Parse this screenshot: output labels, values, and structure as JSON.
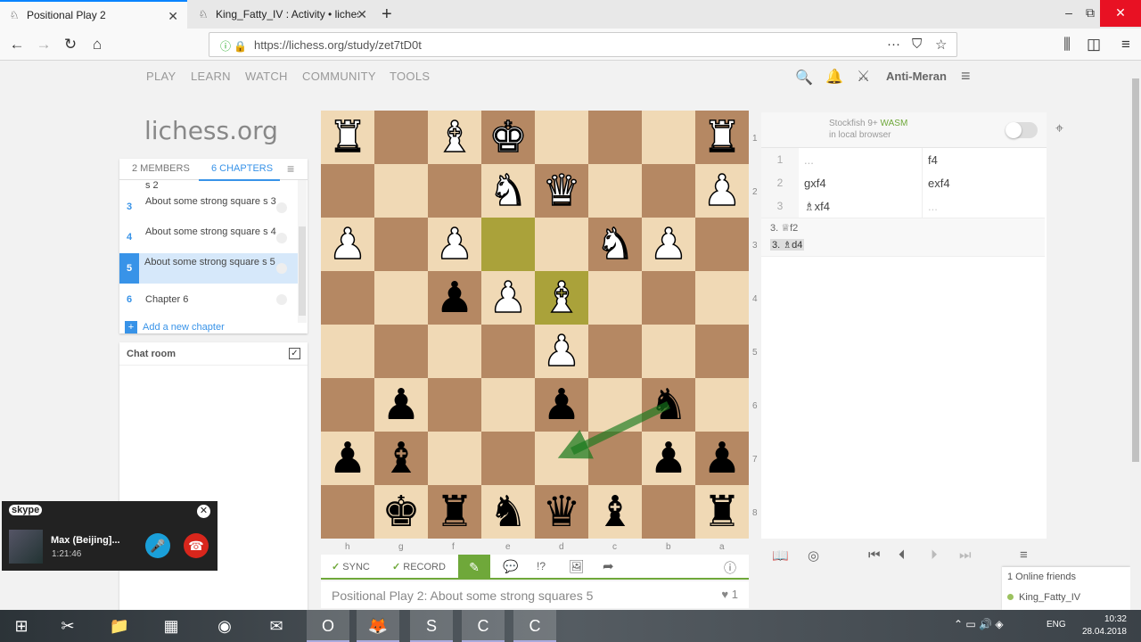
{
  "browser": {
    "tabs": [
      {
        "title": "Positional Play 2",
        "active": true
      },
      {
        "title": "King_Fatty_IV : Activity • liches",
        "active": false
      }
    ],
    "url": "https://lichess.org/study/zet7tD0t",
    "new_tab": "+",
    "window_buttons": [
      "–",
      "⧉",
      "✕"
    ]
  },
  "site": {
    "logo": "lichess.org",
    "nav": [
      "PLAY",
      "LEARN",
      "WATCH",
      "COMMUNITY",
      "TOOLS"
    ],
    "username": "Anti-Meran"
  },
  "study": {
    "tabs": [
      "2 MEMBERS",
      "6 CHAPTERS"
    ],
    "chapters": [
      {
        "num": "",
        "name": "s 2"
      },
      {
        "num": "3",
        "name": "About some strong square s 3"
      },
      {
        "num": "4",
        "name": "About some strong square s 4"
      },
      {
        "num": "5",
        "name": "About some strong square s 5",
        "selected": true
      },
      {
        "num": "6",
        "name": "Chapter 6"
      }
    ],
    "add_chapter": "Add a new chapter",
    "chat_title": "Chat room",
    "chat_checked": "✓",
    "title": "Positional Play 2: About some strong squares 5",
    "likes": "1"
  },
  "board": {
    "orientation": "black",
    "ranks": [
      "1",
      "2",
      "3",
      "4",
      "5",
      "6",
      "7",
      "8"
    ],
    "files": [
      "h",
      "g",
      "f",
      "e",
      "d",
      "c",
      "b",
      "a"
    ],
    "last_move": [
      "e3",
      "d4"
    ],
    "arrow": "b6-d7",
    "pieces": [
      {
        "sq": "h1",
        "p": "wR"
      },
      {
        "sq": "f1",
        "p": "wB"
      },
      {
        "sq": "e1",
        "p": "wK"
      },
      {
        "sq": "a1",
        "p": "wR"
      },
      {
        "sq": "e2",
        "p": "wN"
      },
      {
        "sq": "d2",
        "p": "wQ"
      },
      {
        "sq": "a2",
        "p": "wP"
      },
      {
        "sq": "h3",
        "p": "wP"
      },
      {
        "sq": "f3",
        "p": "wP"
      },
      {
        "sq": "c3",
        "p": "wN"
      },
      {
        "sq": "b3",
        "p": "wP"
      },
      {
        "sq": "f4",
        "p": "bP"
      },
      {
        "sq": "e4",
        "p": "wP"
      },
      {
        "sq": "d4",
        "p": "wB"
      },
      {
        "sq": "d5",
        "p": "wP"
      },
      {
        "sq": "g6",
        "p": "bP"
      },
      {
        "sq": "d6",
        "p": "bP"
      },
      {
        "sq": "b6",
        "p": "bN"
      },
      {
        "sq": "h7",
        "p": "bP"
      },
      {
        "sq": "g7",
        "p": "bB"
      },
      {
        "sq": "b7",
        "p": "bP"
      },
      {
        "sq": "a7",
        "p": "bP"
      },
      {
        "sq": "g8",
        "p": "bK"
      },
      {
        "sq": "f8",
        "p": "bR"
      },
      {
        "sq": "e8",
        "p": "bN"
      },
      {
        "sq": "d8",
        "p": "bQ"
      },
      {
        "sq": "c8",
        "p": "bB"
      },
      {
        "sq": "a8",
        "p": "bR"
      }
    ],
    "tools": {
      "sync": "SYNC",
      "record": "RECORD",
      "sync_check": "✓",
      "record_check": "✓"
    }
  },
  "analysis": {
    "engine_name": "Stockfish 9+",
    "engine_tag": "WASM",
    "engine_sub": "in local browser",
    "moves": [
      {
        "n": "1",
        "white": "...",
        "black": "f4"
      },
      {
        "n": "2",
        "white": "gxf4",
        "black": "exf4"
      },
      {
        "n": "3",
        "white": "♗xf4",
        "black": "..."
      }
    ],
    "variations": [
      "3. ♕f2",
      "3. ♗d4"
    ],
    "online_friends": "1 Online friends",
    "friend": "King_Fatty_IV"
  },
  "skype": {
    "logo": "skype",
    "caller": "Max (Beijing]...",
    "duration": "1:21:46"
  },
  "taskbar": {
    "lang": "ENG",
    "time": "10:32",
    "date": "28.04.2018"
  },
  "colors": {
    "accent": "#3893e8",
    "green": "#6fa83a",
    "light_sq": "#f0d9b5",
    "dark_sq": "#b58863",
    "highlight": "#aaa23a"
  }
}
